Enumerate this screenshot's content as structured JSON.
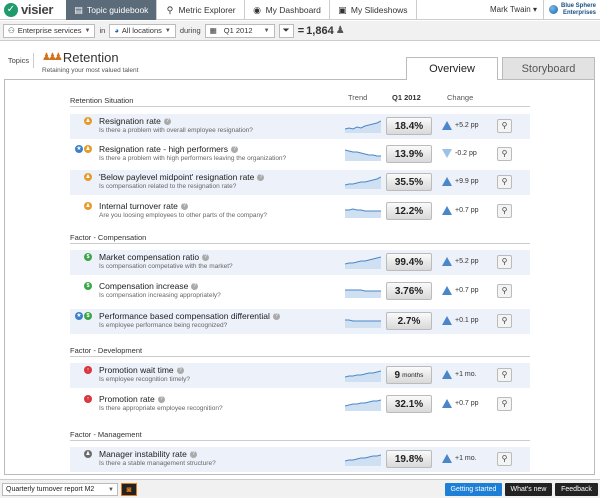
{
  "app": {
    "name": "visier"
  },
  "nav": {
    "tabs": [
      {
        "label": "Topic guidebook",
        "icon": "book-icon",
        "active": true
      },
      {
        "label": "Metric Explorer",
        "icon": "search-icon",
        "active": false
      },
      {
        "label": "My Dashboard",
        "icon": "eye-icon",
        "active": false
      },
      {
        "label": "My Slideshows",
        "icon": "slides-icon",
        "active": false
      }
    ],
    "user": "Mark Twain ▾",
    "company_line1": "Blue Sphere",
    "company_line2": "Enterprises"
  },
  "filters": {
    "population": "Enterprise services",
    "in_label": "in",
    "location": "All locations",
    "during_label": "during",
    "period": "Q1 2012",
    "equals": "=",
    "headcount": "1,864"
  },
  "header": {
    "topics_label": "Topics",
    "title": "Retention",
    "subtitle": "Retaining your most valued talent",
    "tabs": {
      "overview": "Overview",
      "storyboard": "Storyboard"
    }
  },
  "columns": {
    "trend": "Trend",
    "period": "Q1 2012",
    "change": "Change"
  },
  "sections": [
    {
      "title": "Retention Situation",
      "rows": [
        {
          "title": "Resignation rate",
          "question": "Is there a problem with overall employee resignation?",
          "value": "18.4%",
          "unit": "",
          "direction": "up",
          "change": "+5.2 pp",
          "star": false,
          "category": "emp",
          "trend": [
            4,
            5,
            4,
            6,
            5,
            7,
            8,
            9,
            10,
            12
          ]
        },
        {
          "title": "Resignation rate - high performers",
          "question": "Is there a problem with high performers leaving the organization?",
          "value": "13.9%",
          "unit": "",
          "direction": "down",
          "change": "-0.2 pp",
          "star": true,
          "category": "emp",
          "trend": [
            11,
            10,
            9,
            9,
            8,
            7,
            6,
            6,
            5,
            5
          ]
        },
        {
          "title": "'Below paylevel midpoint' resignation rate",
          "question": "Is compensation related to the resignation rate?",
          "value": "35.5%",
          "unit": "",
          "direction": "up",
          "change": "+9.9 pp",
          "star": false,
          "category": "emp",
          "trend": [
            4,
            5,
            5,
            6,
            7,
            7,
            8,
            9,
            10,
            12
          ]
        },
        {
          "title": "Internal turnover rate",
          "question": "Are you loosing employees to other parts of the company?",
          "value": "12.2%",
          "unit": "",
          "direction": "up",
          "change": "+0.7 pp",
          "star": false,
          "category": "emp",
          "trend": [
            8,
            8,
            9,
            8,
            8,
            7,
            7,
            7,
            7,
            7
          ]
        }
      ]
    },
    {
      "title": "Factor - Compensation",
      "rows": [
        {
          "title": "Market compensation ratio",
          "question": "Is compensation competative with the market?",
          "value": "99.4%",
          "unit": "",
          "direction": "up",
          "change": "+5.2 pp",
          "star": false,
          "category": "comp",
          "trend": [
            5,
            6,
            6,
            7,
            8,
            8,
            9,
            10,
            11,
            12
          ]
        },
        {
          "title": "Compensation increase",
          "question": "Is compensation increasing appropriately?",
          "value": "3.76%",
          "unit": "",
          "direction": "up",
          "change": "+0.7 pp",
          "star": false,
          "category": "comp",
          "trend": [
            8,
            8,
            8,
            8,
            8,
            7,
            7,
            7,
            7,
            7
          ]
        },
        {
          "title": "Performance based compensation differential",
          "question": "Is employee performance being recognized?",
          "value": "2.7%",
          "unit": "",
          "direction": "up",
          "change": "+0.1 pp",
          "star": true,
          "category": "comp",
          "trend": [
            8,
            8,
            7,
            7,
            7,
            7,
            7,
            7,
            7,
            7
          ]
        }
      ]
    },
    {
      "title": "Factor - Development",
      "rows": [
        {
          "title": "Promotion wait time",
          "question": "Is employee recognition timely?",
          "value": "9",
          "unit": "months",
          "direction": "up",
          "change": "+1 mo.",
          "star": false,
          "category": "dev",
          "trend": [
            5,
            6,
            6,
            7,
            7,
            8,
            9,
            9,
            10,
            11
          ]
        },
        {
          "title": "Promotion rate",
          "question": "Is there appropriate employee recognition?",
          "value": "32.1%",
          "unit": "",
          "direction": "up",
          "change": "+0.7 pp",
          "star": false,
          "category": "dev",
          "trend": [
            5,
            6,
            7,
            7,
            8,
            8,
            9,
            10,
            10,
            11
          ]
        }
      ]
    },
    {
      "title": "Factor - Management",
      "rows": [
        {
          "title": "Manager instability rate",
          "question": "Is there a stable management structure?",
          "value": "19.8%",
          "unit": "",
          "direction": "up",
          "change": "+1 mo.",
          "star": false,
          "category": "mgmt",
          "trend": [
            5,
            6,
            6,
            7,
            8,
            8,
            9,
            10,
            10,
            11
          ]
        }
      ]
    }
  ],
  "footer": {
    "report": "Quarterly turnover report M2",
    "getting_started": "Getting started",
    "whats_new": "What's new",
    "feedback": "Feedback"
  },
  "colors": {
    "accent": "#1e7fd6",
    "up_arrow": "#4a86c9",
    "down_arrow": "#9cc0e6",
    "spark": "#4a86c9",
    "spark_fill": "#cfe0f2"
  }
}
